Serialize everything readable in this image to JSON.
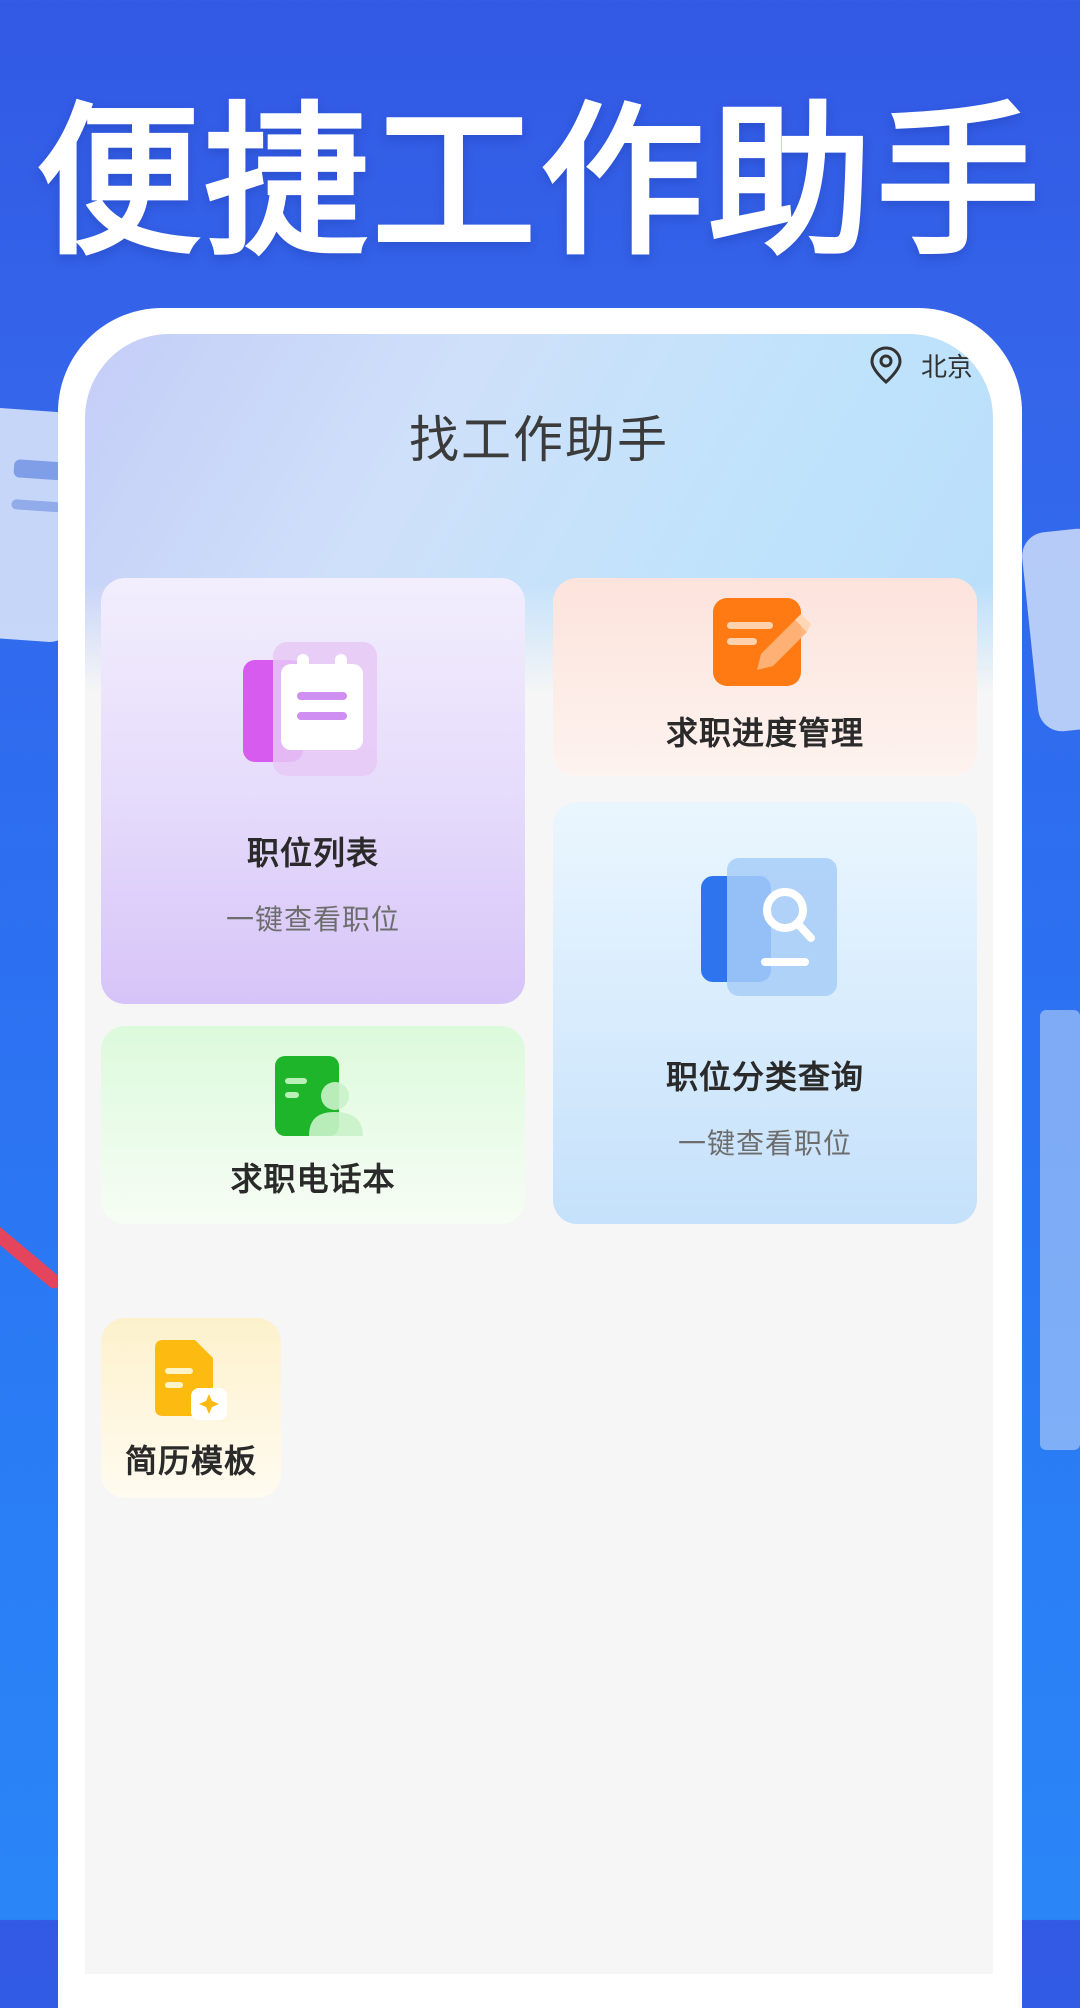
{
  "headline": "便捷工作助手",
  "location": {
    "text": "北京"
  },
  "app_title": "找工作助手",
  "cards": {
    "job_list": {
      "title": "职位列表",
      "subtitle": "一键查看职位"
    },
    "progress": {
      "title": "求职进度管理"
    },
    "phonebook": {
      "title": "求职电话本"
    },
    "category": {
      "title": "职位分类查询",
      "subtitle": "一键查看职位"
    },
    "resume": {
      "title": "简历模板"
    }
  },
  "icons": {
    "job_list": "clipboard-icon",
    "progress": "note-pencil-icon",
    "phonebook": "contact-book-icon",
    "category": "search-document-icon",
    "resume": "resume-document-icon",
    "location": "location-pin-icon"
  },
  "colors": {
    "background": "#3259e4",
    "purple": "#d65bee",
    "orange": "#ff7a12",
    "green": "#1fb52a",
    "blue": "#2f74ef",
    "yellow": "#fdbb12"
  }
}
